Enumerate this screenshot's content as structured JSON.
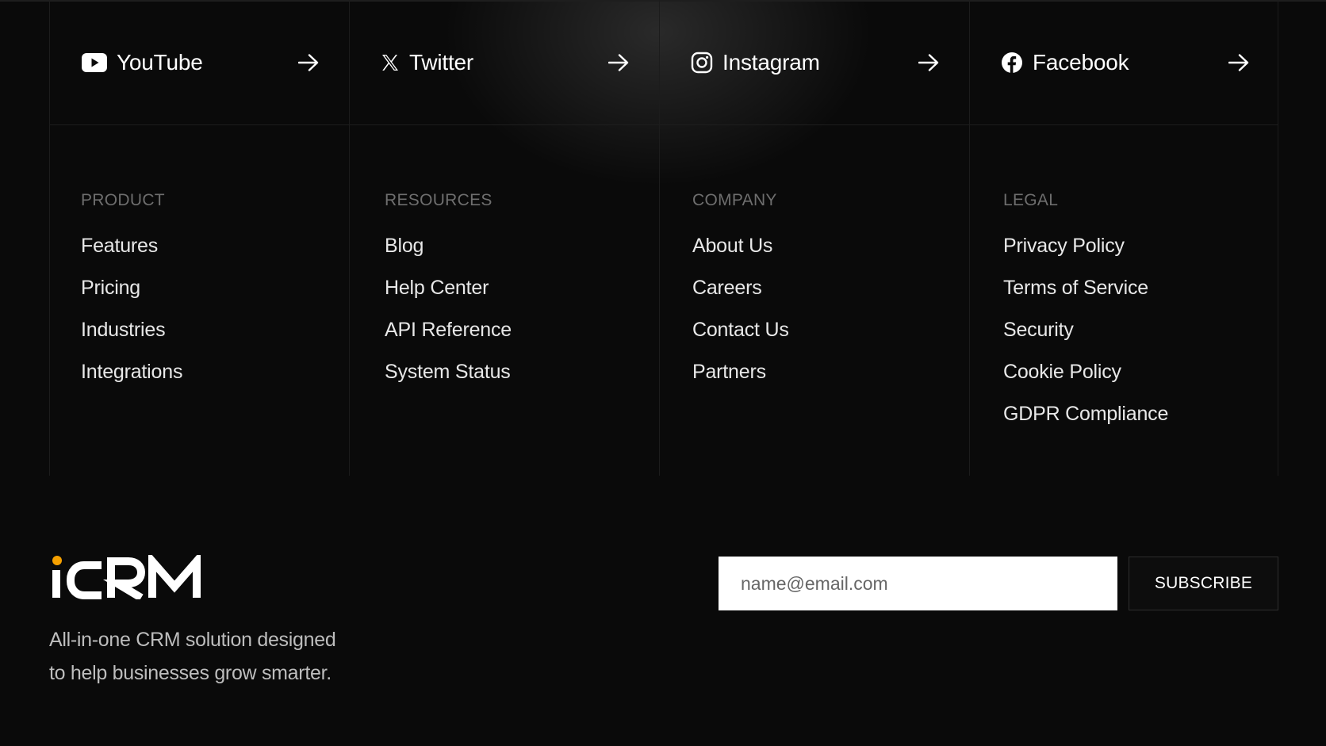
{
  "social": [
    {
      "label": "YouTube",
      "icon": "youtube-icon"
    },
    {
      "label": "Twitter",
      "icon": "x-twitter-icon"
    },
    {
      "label": "Instagram",
      "icon": "instagram-icon"
    },
    {
      "label": "Facebook",
      "icon": "facebook-icon"
    }
  ],
  "columns": [
    {
      "heading": "PRODUCT",
      "links": [
        "Features",
        "Pricing",
        "Industries",
        "Integrations"
      ]
    },
    {
      "heading": "RESOURCES",
      "links": [
        "Blog",
        "Help Center",
        "API Reference",
        "System Status"
      ]
    },
    {
      "heading": "COMPANY",
      "links": [
        "About Us",
        "Careers",
        "Contact Us",
        "Partners"
      ]
    },
    {
      "heading": "LEGAL",
      "links": [
        "Privacy Policy",
        "Terms of Service",
        "Security",
        "Cookie Policy",
        "GDPR Compliance"
      ]
    }
  ],
  "brand": {
    "logo_text": "iCRM",
    "tagline_line1": "All-in-one CRM solution designed",
    "tagline_line2": "to help businesses grow smarter.",
    "accent_color": "#f5a000"
  },
  "newsletter": {
    "placeholder": "name@email.com",
    "value": "",
    "button_label": "SUBSCRIBE"
  }
}
